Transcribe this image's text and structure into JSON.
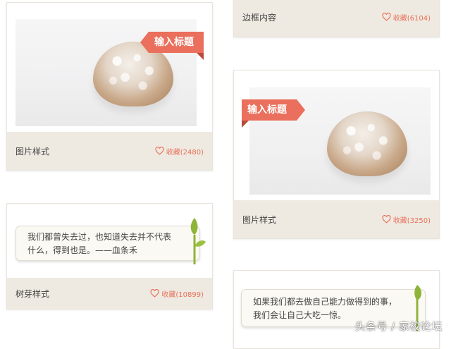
{
  "cards": {
    "image_card_1": {
      "ribbon_title": "输入标题",
      "footer_title": "图片样式",
      "favorite_label": "收藏(2480)"
    },
    "border_card": {
      "footer_title": "边框内容",
      "favorite_label": "收藏(6104)"
    },
    "image_card_2": {
      "ribbon_title": "输入标题",
      "footer_title": "图片样式",
      "favorite_label": "收藏(3250)"
    },
    "sprout_card": {
      "quote_lines": [
        "我们都曾失去过，也知道失去并不代表",
        "什么，得到也是。——血条禾"
      ],
      "footer_title": "树芽样式",
      "favorite_label": "收藏(10899)"
    },
    "sprout_card_2": {
      "quote_lines": [
        "如果我们都去做自己能力做得到的事，",
        "我们会让自己大吃一惊。"
      ]
    }
  },
  "watermark": "头条号 / 家校论坛",
  "colors": {
    "accent": "#ea6f5c",
    "footer_bg": "#efeae1",
    "sprout_green": "#8fb43a"
  },
  "icons": {
    "favorite": "heart-outline-icon",
    "sprout": "sprout-icon"
  }
}
